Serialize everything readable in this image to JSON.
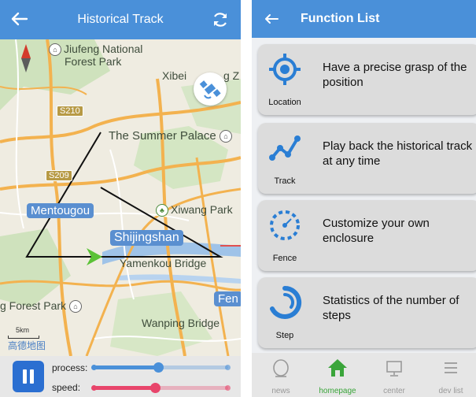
{
  "left_screen": {
    "title": "Historical Track",
    "map_labels": {
      "jiufeng": "Jiufeng National",
      "forest_park": "Forest Park",
      "xibei": "Xibei",
      "xibei_tail": "g Z",
      "s210": "S210",
      "s209": "S209",
      "summer_palace": "The Summer Palace",
      "mentougou": "Mentougou",
      "xiwang": "Xiwang Park",
      "shijingshan": "Shijingshan",
      "yamenkou": "Yamenkou Bridge",
      "forest_park_2": "g Forest Park",
      "fen": "Fen",
      "wanping": "Wanping Bridge",
      "scale": "5km",
      "logo": "高德地图"
    },
    "controls": {
      "process_label": "process:",
      "speed_label": "speed:",
      "process_value": 0.48,
      "speed_value": 0.46,
      "process_color": "#4a90d9",
      "speed_color": "#e8456b"
    },
    "colors": {
      "header": "#4a90d9",
      "track_line": "#111111",
      "arrow": "#5bc236",
      "pause_button": "#2b6fd1"
    }
  },
  "right_screen": {
    "title": "Function List",
    "cards": [
      {
        "icon": "location-target-icon",
        "label": "Location",
        "desc": "Have a precise grasp of the position"
      },
      {
        "icon": "track-path-icon",
        "label": "Track",
        "desc": "Play back the historical track at any time"
      },
      {
        "icon": "fence-circle-icon",
        "label": "Fence",
        "desc": "Customize your own enclosure"
      },
      {
        "icon": "step-swirl-icon",
        "label": "Step",
        "desc": "Statistics of the number of steps"
      }
    ],
    "nav": [
      {
        "icon": "news-icon",
        "label": "news"
      },
      {
        "icon": "home-icon",
        "label": "homepage",
        "active": true
      },
      {
        "icon": "monitor-icon",
        "label": "center"
      },
      {
        "icon": "list-icon",
        "label": "dev list"
      }
    ],
    "colors": {
      "header": "#4a90d9",
      "icon_blue": "#2a7ed4",
      "nav_active": "#3aa53a"
    }
  }
}
